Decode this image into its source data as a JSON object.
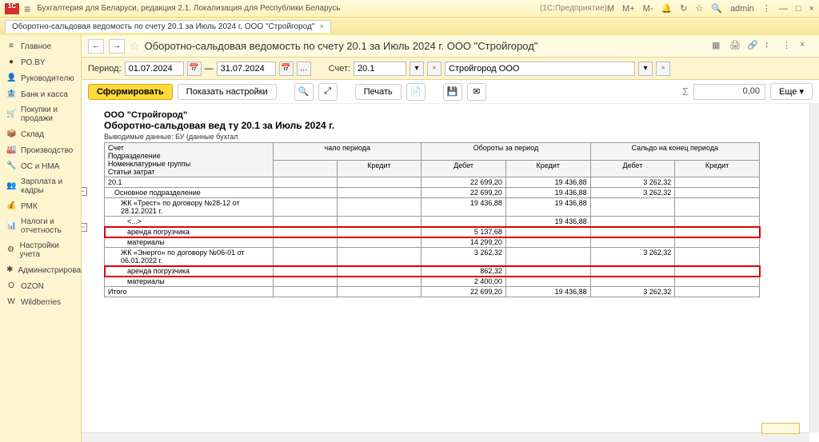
{
  "titlebar": {
    "app_title": "Бухгалтерия для Беларуси, редакция 2.1. Локализация для Республики Беларусь",
    "app_mode": "(1С:Предприятие)",
    "right": {
      "m": "M",
      "mp": "M+",
      "mm": "M-",
      "user": "admin"
    }
  },
  "tabs": [
    {
      "label": "Оборотно-сальдовая ведомость по счету 20.1 за Июль 2024 г. ООО \"Стройгород\""
    }
  ],
  "sidebar": {
    "items": [
      {
        "label": "Главное",
        "icon": "≡"
      },
      {
        "label": "PO.BY",
        "icon": "●"
      },
      {
        "label": "Руководителю",
        "icon": "👤"
      },
      {
        "label": "Банк и касса",
        "icon": "🏦"
      },
      {
        "label": "Покупки и продажи",
        "icon": "🛒"
      },
      {
        "label": "Склад",
        "icon": "📦"
      },
      {
        "label": "Производство",
        "icon": "🏭"
      },
      {
        "label": "ОС и НМА",
        "icon": "🔧"
      },
      {
        "label": "Зарплата и кадры",
        "icon": "👥"
      },
      {
        "label": "РМК",
        "icon": "💰"
      },
      {
        "label": "Налоги и отчетность",
        "icon": "📊"
      },
      {
        "label": "Настройки учета",
        "icon": "⚙"
      },
      {
        "label": "Администрирование",
        "icon": "✱"
      },
      {
        "label": "OZON",
        "icon": "O"
      },
      {
        "label": "Wildberries",
        "icon": "W"
      }
    ]
  },
  "header": {
    "title": "Оборотно-сальдовая ведомость по счету 20.1 за Июль 2024 г. ООО \"Стройгород\""
  },
  "filter": {
    "period_label": "Период:",
    "from": "01.07.2024",
    "to": "31.07.2024",
    "dash": "—",
    "account_label": "Счет:",
    "account": "20.1",
    "org": "Стройгород ООО"
  },
  "toolbar": {
    "form": "Сформировать",
    "show_settings": "Показать настройки",
    "print": "Печать",
    "sum": "0,00",
    "more": "Еще"
  },
  "report": {
    "org": "ООО \"Стройгород\"",
    "title": "Оборотно-сальдовая вед ту 20.1 за Июль 2024 г.",
    "sub": "Выводимые данные:    БУ (данные бухгал",
    "head": {
      "account": "Счет",
      "div": "Подразделение",
      "nomgrp": "Номенклатурные группы",
      "costitem": "Статьи затрат",
      "period_start": "чало периода",
      "turnover": "Обороты за период",
      "period_end": "Сальдо на конец периода",
      "debit": "Дебет",
      "credit": "Кредит"
    },
    "rows": [
      {
        "label": "20.1",
        "sd": "",
        "sc": "",
        "td": "22 699,20",
        "tc": "19 436,88",
        "ed": "3 262,32",
        "ec": ""
      },
      {
        "label": "Основное подразделение",
        "sd": "",
        "sc": "",
        "td": "22 699,20",
        "tc": "19 436,88",
        "ed": "3 262,32",
        "ec": ""
      },
      {
        "label": "ЖК «Трест» по договору №28-12 от 28.12.2021 г.",
        "sd": "",
        "sc": "",
        "td": "19 436,88",
        "tc": "19 436,88",
        "ed": "",
        "ec": ""
      },
      {
        "label": "<...>",
        "sd": "",
        "sc": "",
        "td": "",
        "tc": "19 436,88",
        "ed": "",
        "ec": ""
      },
      {
        "label": "аренда погрузчика",
        "sd": "",
        "sc": "",
        "td": "5 137,68",
        "tc": "",
        "ed": "",
        "ec": "",
        "hl": true
      },
      {
        "label": "материалы",
        "sd": "",
        "sc": "",
        "td": "14 299,20",
        "tc": "",
        "ed": "",
        "ec": ""
      },
      {
        "label": "ЖК «Энерго» по договору №06-01 от 06.01.2022 г.",
        "sd": "",
        "sc": "",
        "td": "3 262,32",
        "tc": "",
        "ed": "3 262,32",
        "ec": ""
      },
      {
        "label": "аренда погрузчика",
        "sd": "",
        "sc": "",
        "td": "862,32",
        "tc": "",
        "ed": "",
        "ec": "",
        "hl": true
      },
      {
        "label": "материалы",
        "sd": "",
        "sc": "",
        "td": "2 400,00",
        "tc": "",
        "ed": "",
        "ec": ""
      }
    ],
    "total": {
      "label": "Итого",
      "td": "22 699,20",
      "tc": "19 436,88",
      "ed": "3 262,32"
    }
  }
}
